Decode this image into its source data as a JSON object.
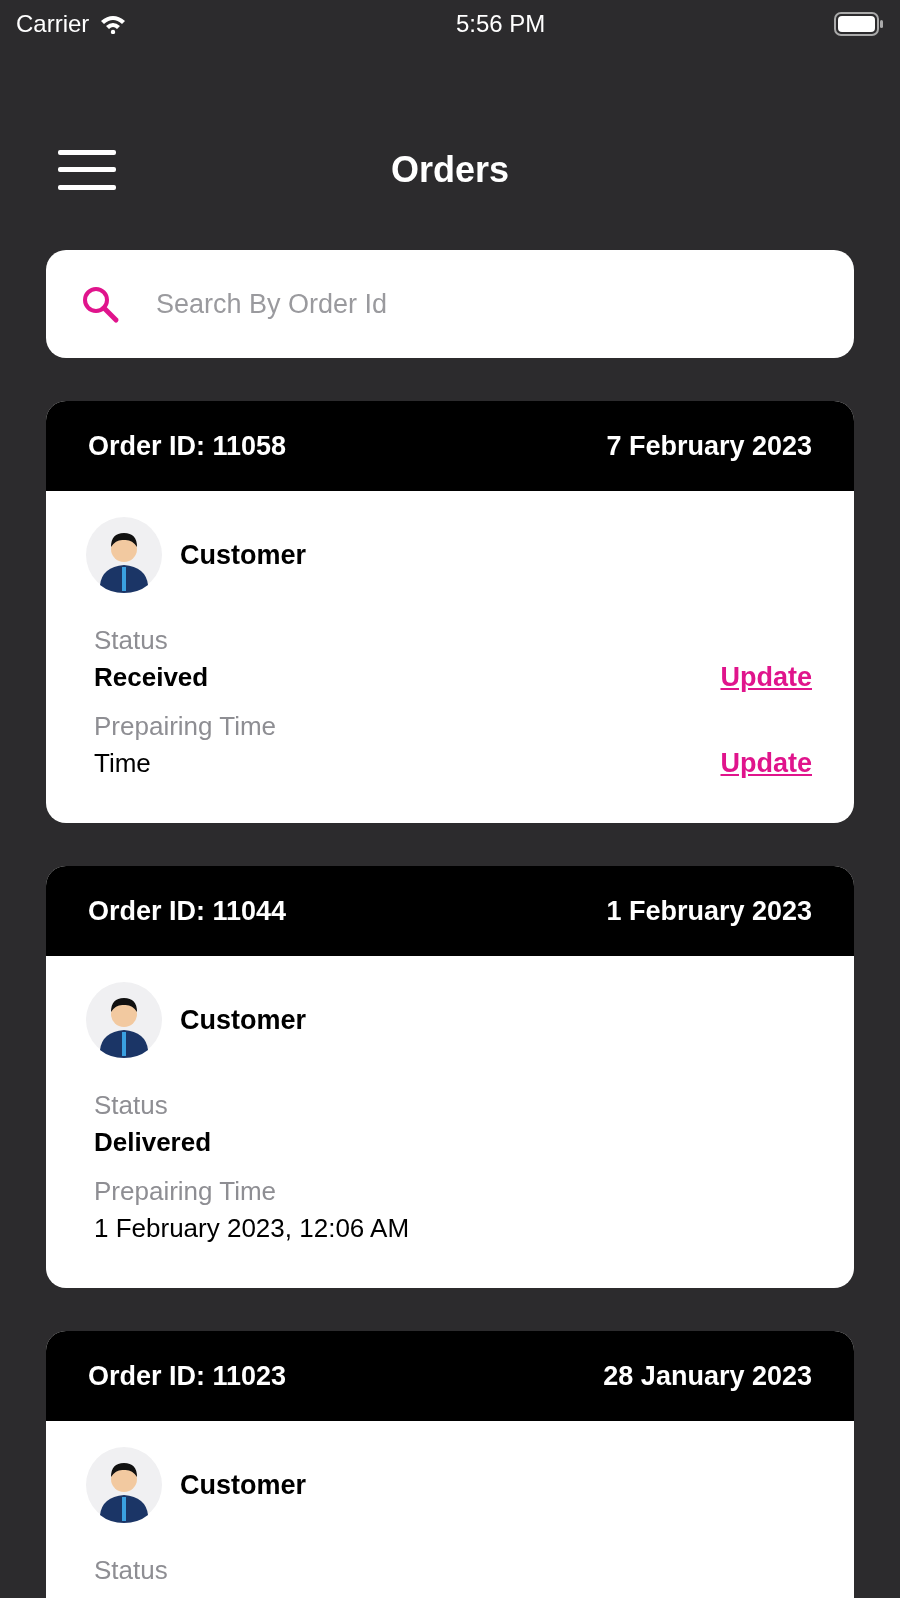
{
  "status_bar": {
    "carrier": "Carrier",
    "time": "5:56 PM"
  },
  "header": {
    "title": "Orders"
  },
  "search": {
    "placeholder": "Search By Order Id"
  },
  "orders": [
    {
      "order_id": "Order ID: 11058",
      "date": "7 February 2023",
      "customer": "Customer",
      "status_label": "Status",
      "status": "Received",
      "status_action": "Update",
      "time_label": "Prepairing Time",
      "time": "Time",
      "time_action": "Update"
    },
    {
      "order_id": "Order ID: 11044",
      "date": "1 February 2023",
      "customer": "Customer",
      "status_label": "Status",
      "status": "Delivered",
      "time_label": "Prepairing Time",
      "time": "1 February 2023, 12:06 AM"
    },
    {
      "order_id": "Order ID: 11023",
      "date": "28 January 2023",
      "customer": "Customer",
      "status_label": "Status"
    }
  ]
}
